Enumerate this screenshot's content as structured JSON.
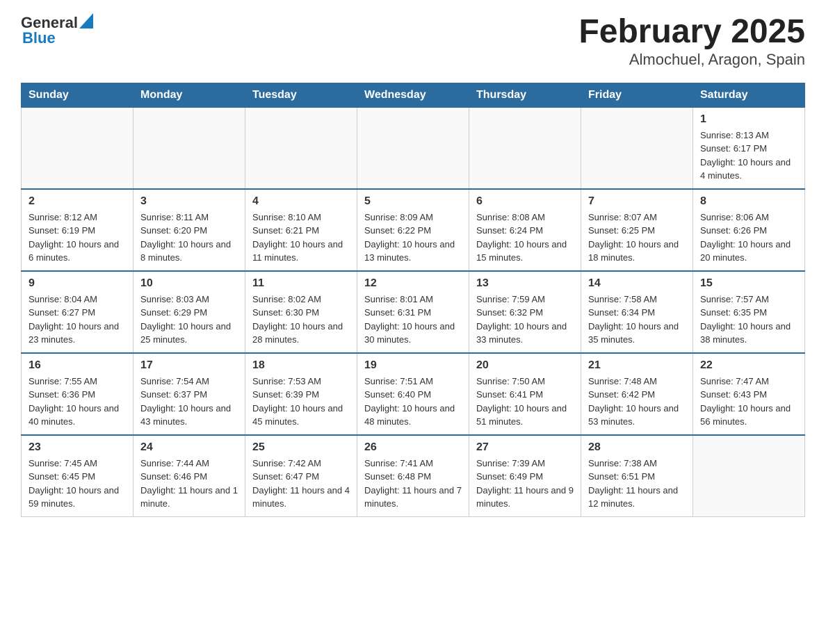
{
  "header": {
    "logo": {
      "general": "General",
      "blue": "Blue"
    },
    "title": "February 2025",
    "subtitle": "Almochuel, Aragon, Spain"
  },
  "calendar": {
    "days_of_week": [
      "Sunday",
      "Monday",
      "Tuesday",
      "Wednesday",
      "Thursday",
      "Friday",
      "Saturday"
    ],
    "weeks": [
      [
        {
          "day": "",
          "info": ""
        },
        {
          "day": "",
          "info": ""
        },
        {
          "day": "",
          "info": ""
        },
        {
          "day": "",
          "info": ""
        },
        {
          "day": "",
          "info": ""
        },
        {
          "day": "",
          "info": ""
        },
        {
          "day": "1",
          "info": "Sunrise: 8:13 AM\nSunset: 6:17 PM\nDaylight: 10 hours and 4 minutes."
        }
      ],
      [
        {
          "day": "2",
          "info": "Sunrise: 8:12 AM\nSunset: 6:19 PM\nDaylight: 10 hours and 6 minutes."
        },
        {
          "day": "3",
          "info": "Sunrise: 8:11 AM\nSunset: 6:20 PM\nDaylight: 10 hours and 8 minutes."
        },
        {
          "day": "4",
          "info": "Sunrise: 8:10 AM\nSunset: 6:21 PM\nDaylight: 10 hours and 11 minutes."
        },
        {
          "day": "5",
          "info": "Sunrise: 8:09 AM\nSunset: 6:22 PM\nDaylight: 10 hours and 13 minutes."
        },
        {
          "day": "6",
          "info": "Sunrise: 8:08 AM\nSunset: 6:24 PM\nDaylight: 10 hours and 15 minutes."
        },
        {
          "day": "7",
          "info": "Sunrise: 8:07 AM\nSunset: 6:25 PM\nDaylight: 10 hours and 18 minutes."
        },
        {
          "day": "8",
          "info": "Sunrise: 8:06 AM\nSunset: 6:26 PM\nDaylight: 10 hours and 20 minutes."
        }
      ],
      [
        {
          "day": "9",
          "info": "Sunrise: 8:04 AM\nSunset: 6:27 PM\nDaylight: 10 hours and 23 minutes."
        },
        {
          "day": "10",
          "info": "Sunrise: 8:03 AM\nSunset: 6:29 PM\nDaylight: 10 hours and 25 minutes."
        },
        {
          "day": "11",
          "info": "Sunrise: 8:02 AM\nSunset: 6:30 PM\nDaylight: 10 hours and 28 minutes."
        },
        {
          "day": "12",
          "info": "Sunrise: 8:01 AM\nSunset: 6:31 PM\nDaylight: 10 hours and 30 minutes."
        },
        {
          "day": "13",
          "info": "Sunrise: 7:59 AM\nSunset: 6:32 PM\nDaylight: 10 hours and 33 minutes."
        },
        {
          "day": "14",
          "info": "Sunrise: 7:58 AM\nSunset: 6:34 PM\nDaylight: 10 hours and 35 minutes."
        },
        {
          "day": "15",
          "info": "Sunrise: 7:57 AM\nSunset: 6:35 PM\nDaylight: 10 hours and 38 minutes."
        }
      ],
      [
        {
          "day": "16",
          "info": "Sunrise: 7:55 AM\nSunset: 6:36 PM\nDaylight: 10 hours and 40 minutes."
        },
        {
          "day": "17",
          "info": "Sunrise: 7:54 AM\nSunset: 6:37 PM\nDaylight: 10 hours and 43 minutes."
        },
        {
          "day": "18",
          "info": "Sunrise: 7:53 AM\nSunset: 6:39 PM\nDaylight: 10 hours and 45 minutes."
        },
        {
          "day": "19",
          "info": "Sunrise: 7:51 AM\nSunset: 6:40 PM\nDaylight: 10 hours and 48 minutes."
        },
        {
          "day": "20",
          "info": "Sunrise: 7:50 AM\nSunset: 6:41 PM\nDaylight: 10 hours and 51 minutes."
        },
        {
          "day": "21",
          "info": "Sunrise: 7:48 AM\nSunset: 6:42 PM\nDaylight: 10 hours and 53 minutes."
        },
        {
          "day": "22",
          "info": "Sunrise: 7:47 AM\nSunset: 6:43 PM\nDaylight: 10 hours and 56 minutes."
        }
      ],
      [
        {
          "day": "23",
          "info": "Sunrise: 7:45 AM\nSunset: 6:45 PM\nDaylight: 10 hours and 59 minutes."
        },
        {
          "day": "24",
          "info": "Sunrise: 7:44 AM\nSunset: 6:46 PM\nDaylight: 11 hours and 1 minute."
        },
        {
          "day": "25",
          "info": "Sunrise: 7:42 AM\nSunset: 6:47 PM\nDaylight: 11 hours and 4 minutes."
        },
        {
          "day": "26",
          "info": "Sunrise: 7:41 AM\nSunset: 6:48 PM\nDaylight: 11 hours and 7 minutes."
        },
        {
          "day": "27",
          "info": "Sunrise: 7:39 AM\nSunset: 6:49 PM\nDaylight: 11 hours and 9 minutes."
        },
        {
          "day": "28",
          "info": "Sunrise: 7:38 AM\nSunset: 6:51 PM\nDaylight: 11 hours and 12 minutes."
        },
        {
          "day": "",
          "info": ""
        }
      ]
    ]
  }
}
